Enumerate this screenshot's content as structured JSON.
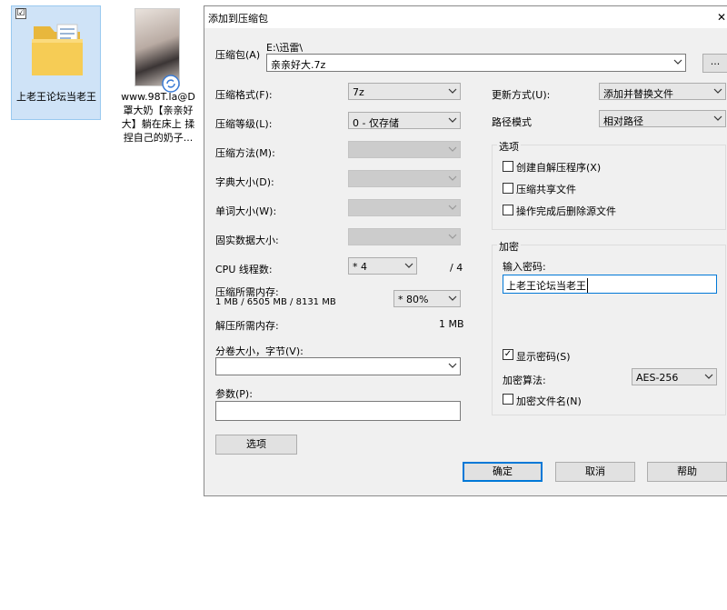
{
  "desktop": {
    "folder_icon": {
      "label": "上老王论坛当老王",
      "checked_mark": "☑"
    },
    "file_icon": {
      "label_line1": "www.98T.la@D",
      "label_line2": "罩大奶【亲亲好",
      "label_line3": "大】躺在床上 揉",
      "label_line4": "捏自己的奶子..."
    }
  },
  "dialog": {
    "title": "添加到压缩包",
    "close_glyph": "✕",
    "archive": {
      "label": "压缩包(A)",
      "path": "E:\\迅雷\\",
      "filename": "亲亲好大.7z",
      "browse_label": "..."
    },
    "left": {
      "format_label": "压缩格式(F):",
      "format_value": "7z",
      "level_label": "压缩等级(L):",
      "level_value": "0 - 仅存储",
      "method_label": "压缩方法(M):",
      "dict_label": "字典大小(D):",
      "word_label": "单词大小(W):",
      "solid_label": "固实数据大小:",
      "cpu_label": "CPU 线程数:",
      "cpu_value": "* 4",
      "cpu_total": "/ 4",
      "mem_label": "压缩所需内存:",
      "mem_detail": "1 MB / 6505 MB / 8131 MB",
      "mem_value": "* 80%",
      "decomp_label": "解压所需内存:",
      "decomp_value": "1 MB",
      "split_label": "分卷大小，字节(V):",
      "split_value": "",
      "params_label": "参数(P):",
      "params_value": "",
      "options_button": "选项"
    },
    "right": {
      "update_label": "更新方式(U):",
      "update_value": "添加并替换文件",
      "path_mode_label": "路径模式",
      "path_mode_value": "相对路径",
      "options_group": {
        "title": "选项",
        "sfx": "创建自解压程序(X)",
        "shared": "压缩共享文件",
        "delete": "操作完成后删除源文件"
      },
      "encrypt_group": {
        "title": "加密",
        "password_label": "输入密码:",
        "password_value": "上老王论坛当老王",
        "show_password": "显示密码(S)",
        "method_label": "加密算法:",
        "method_value": "AES-256",
        "encrypt_names": "加密文件名(N)"
      }
    },
    "buttons": {
      "ok": "确定",
      "cancel": "取消",
      "help": "帮助"
    }
  }
}
